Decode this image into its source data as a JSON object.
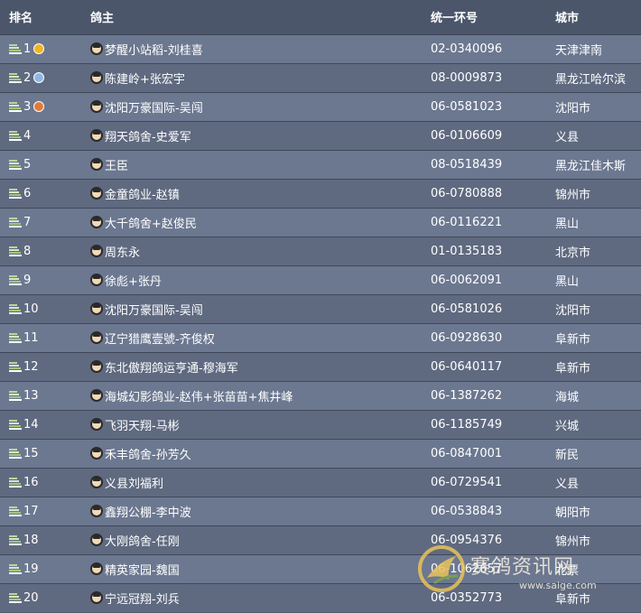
{
  "header": {
    "rank": "排名",
    "owner": "鸽主",
    "ring": "统一环号",
    "city": "城市"
  },
  "rows": [
    {
      "rank": "1",
      "medal": "gold",
      "owner": "梦醒小站稻-刘桂喜",
      "ring": "02-0340096",
      "city": "天津津南"
    },
    {
      "rank": "2",
      "medal": "silver",
      "owner": "陈建岭+张宏宇",
      "ring": "08-0009873",
      "city": "黑龙江哈尔滨"
    },
    {
      "rank": "3",
      "medal": "bronze",
      "owner": "沈阳万豪国际-吴闯",
      "ring": "06-0581023",
      "city": "沈阳市"
    },
    {
      "rank": "4",
      "owner": "翔天鸽舍-史爱军",
      "ring": "06-0106609",
      "city": "义县"
    },
    {
      "rank": "5",
      "owner": "王臣",
      "ring": "08-0518439",
      "city": "黑龙江佳木斯"
    },
    {
      "rank": "6",
      "owner": "金童鸽业-赵镇",
      "ring": "06-0780888",
      "city": "锦州市"
    },
    {
      "rank": "7",
      "owner": "大千鸽舍+赵俊民",
      "ring": "06-0116221",
      "city": "黑山"
    },
    {
      "rank": "8",
      "owner": "周东永",
      "ring": "01-0135183",
      "city": "北京市"
    },
    {
      "rank": "9",
      "owner": "徐彪+张丹",
      "ring": "06-0062091",
      "city": "黑山"
    },
    {
      "rank": "10",
      "owner": "沈阳万豪国际-吴闯",
      "ring": "06-0581026",
      "city": "沈阳市"
    },
    {
      "rank": "11",
      "owner": "辽宁猎鹰壹號-齐俊权",
      "ring": "06-0928630",
      "city": "阜新市"
    },
    {
      "rank": "12",
      "owner": "东北傲翔鸽运亨通-穆海军",
      "ring": "06-0640117",
      "city": "阜新市"
    },
    {
      "rank": "13",
      "owner": "海城幻影鸽业-赵伟+张苗苗+焦井峰",
      "ring": "06-1387262",
      "city": "海城"
    },
    {
      "rank": "14",
      "owner": "飞羽天翔-马彬",
      "ring": "06-1185749",
      "city": "兴城"
    },
    {
      "rank": "15",
      "owner": "禾丰鸽舍-孙芳久",
      "ring": "06-0847001",
      "city": "新民"
    },
    {
      "rank": "16",
      "owner": "义县刘福利",
      "ring": "06-0729541",
      "city": "义县"
    },
    {
      "rank": "17",
      "owner": "鑫翔公棚-李中波",
      "ring": "06-0538843",
      "city": "朝阳市"
    },
    {
      "rank": "18",
      "owner": "大刚鸽舍-任刚",
      "ring": "06-0954376",
      "city": "锦州市"
    },
    {
      "rank": "19",
      "owner": "精英家园-魏国",
      "ring": "06-1062657",
      "city": "北票"
    },
    {
      "rank": "20",
      "owner": "宁远冠翔-刘兵",
      "ring": "06-0352773",
      "city": "阜新市"
    }
  ],
  "watermark": {
    "title": "赛鸽资讯网",
    "url": "www.saige.com"
  },
  "colors": {
    "row_odd": "#6c7890",
    "row_even": "#5f6a80",
    "header_bg": "#4b566b"
  }
}
